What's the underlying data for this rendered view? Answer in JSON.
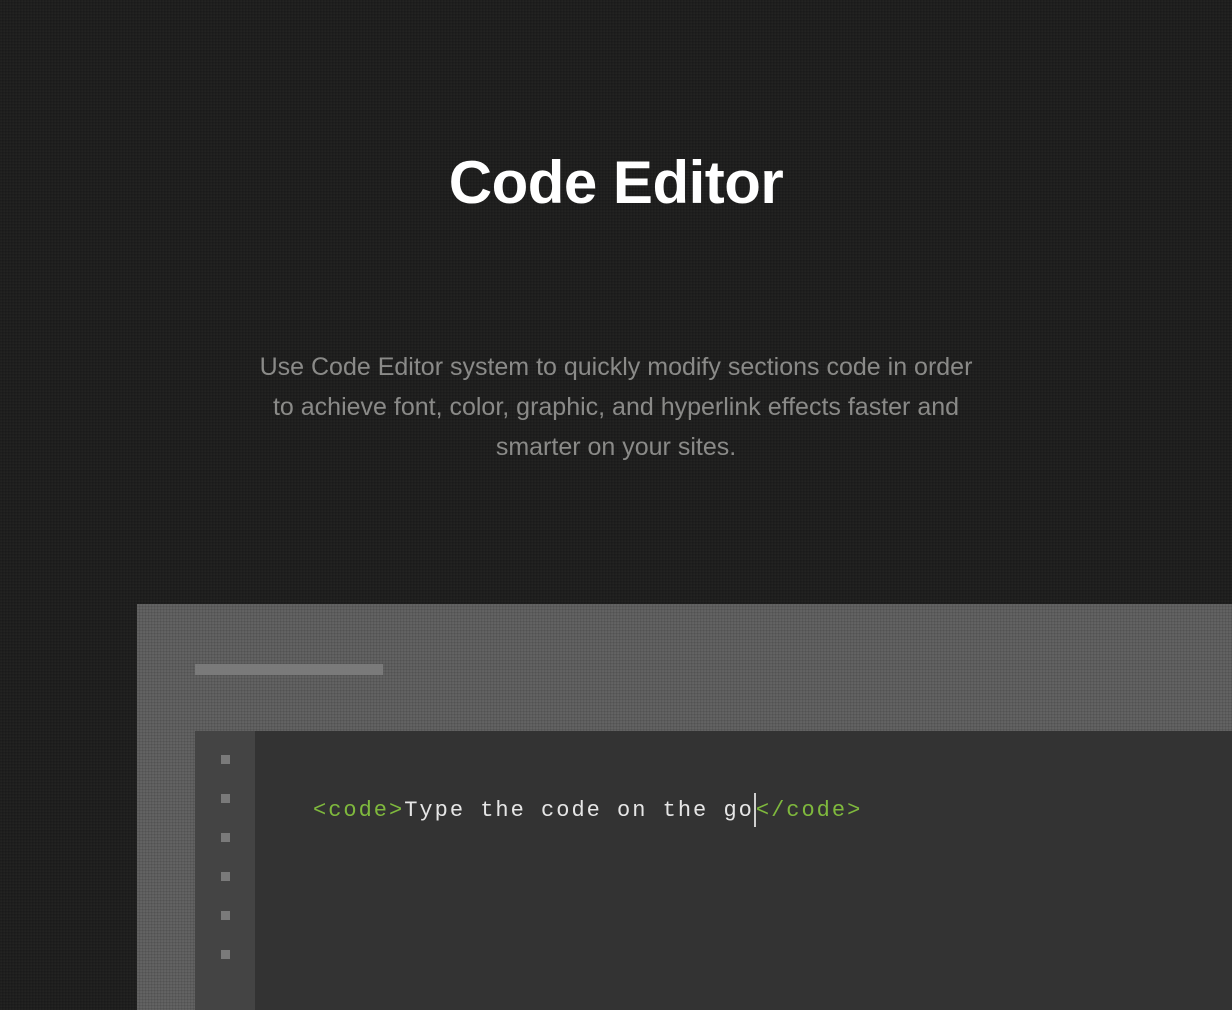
{
  "hero": {
    "title": "Code Editor",
    "description": "Use Code Editor system to quickly modify sections code in order to achieve font, color, graphic, and hyperlink effects faster and smarter on your sites."
  },
  "editor": {
    "gutter_rows": 6,
    "code": {
      "open_tag": "<code>",
      "text": "Type the code on the go",
      "close_tag": "</code>"
    }
  },
  "colors": {
    "tag": "#7fb93d",
    "text": "#e6e6e6",
    "page_bg": "#1f1f1e",
    "frame_bg": "#606060",
    "gutter_bg": "#444444",
    "code_bg": "#333333"
  }
}
